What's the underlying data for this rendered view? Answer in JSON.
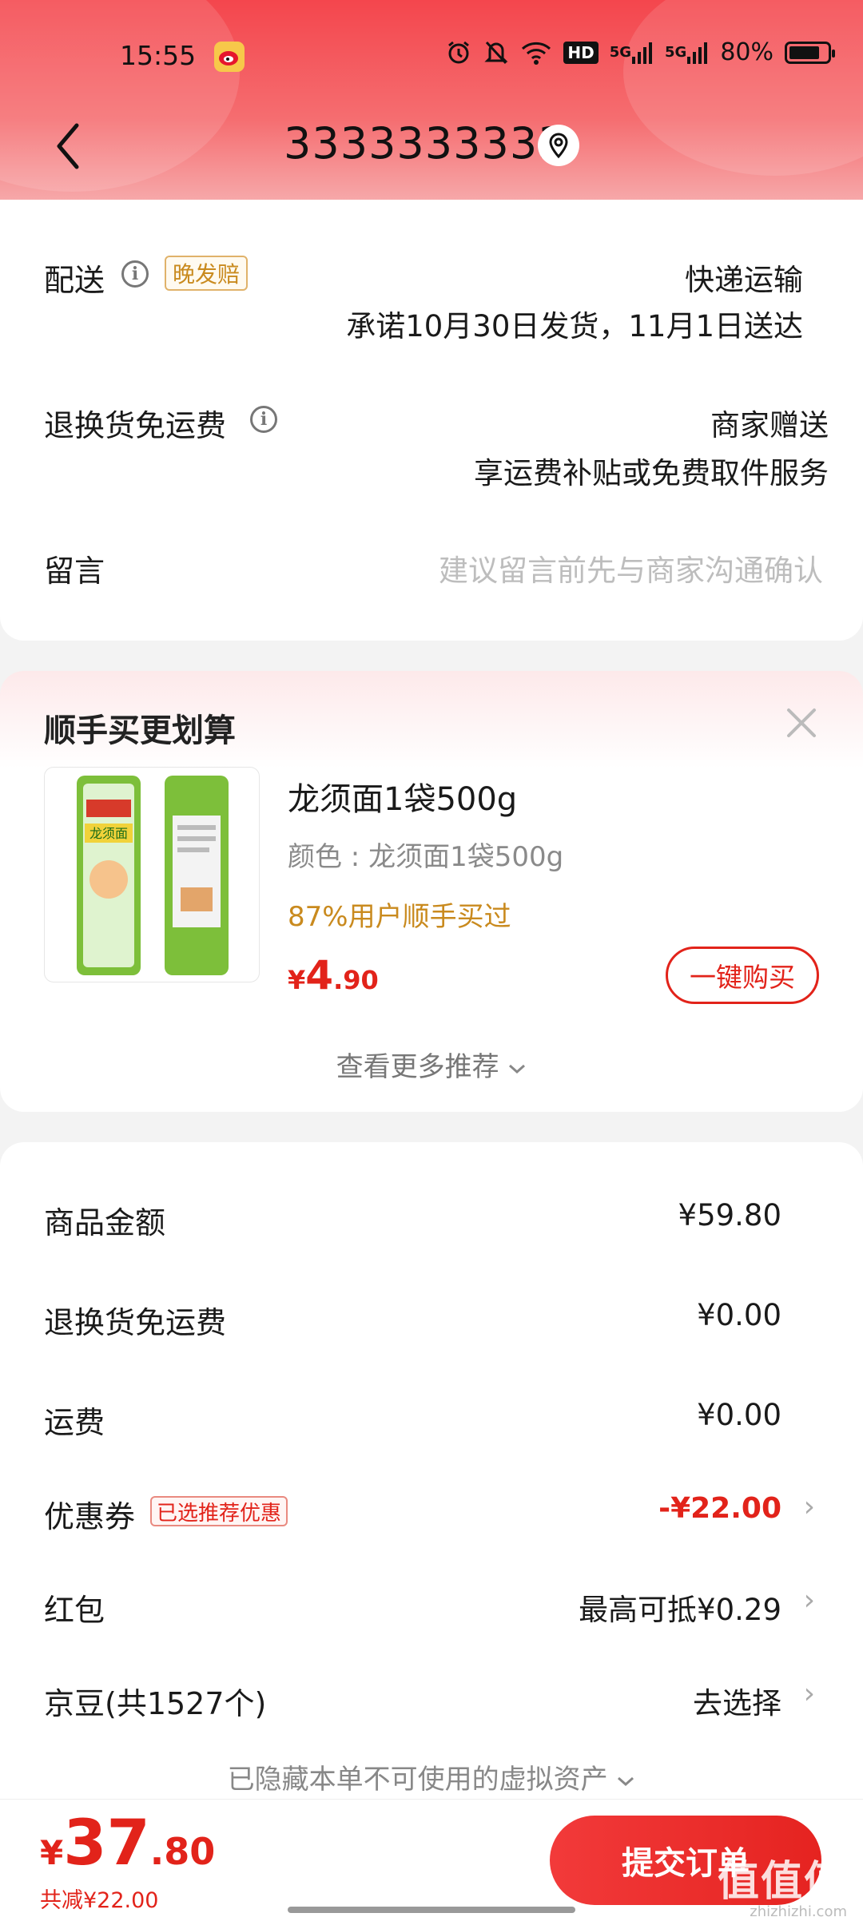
{
  "status_bar": {
    "time": "15:55",
    "network": "5G",
    "network2": "5G",
    "hd_badge": "HD",
    "battery": "80%",
    "battery_level": 0.8
  },
  "nav": {
    "title": "3333333333"
  },
  "delivery": {
    "label": "配送",
    "late_tag": "晚发赔",
    "method": "快递运输",
    "promise": "承诺10月30日发货，11月1日送达",
    "return_label": "退换货免运费",
    "return_value": "商家赠送",
    "return_desc": "享运费补贴或免费取件服务",
    "note_label": "留言",
    "note_placeholder": "建议留言前先与商家沟通确认"
  },
  "recommend": {
    "title": "顺手买更划算",
    "product": {
      "name": "龙须面1袋500g",
      "spec": "颜色 : 龙须面1袋500g",
      "stat": "87%用户顺手买过",
      "price_currency": "¥",
      "price_int": "4",
      "price_dec": ".90",
      "package_text": "龙须面"
    },
    "buy_label": "一键购买",
    "more_label": "查看更多推荐"
  },
  "summary": {
    "goods_label": "商品金额",
    "goods_value": "¥59.80",
    "return_label": "退换货免运费",
    "return_value": "¥0.00",
    "shipping_label": "运费",
    "shipping_value": "¥0.00",
    "coupon_label": "优惠券",
    "coupon_tag": "已选推荐优惠",
    "coupon_value": "-¥22.00",
    "redpacket_label": "红包",
    "redpacket_value": "最高可抵¥0.29",
    "jingdou_label": "京豆(共1527个)",
    "jingdou_value": "去选择",
    "hidden_note": "已隐藏本单不可使用的虚拟资产"
  },
  "bottom": {
    "currency": "¥",
    "total_int": "37",
    "total_dec": ".80",
    "saved": "共减¥22.00",
    "submit_label": "提交订单",
    "watermark": "值值值",
    "watermark_sub": "zhizhizhi.com"
  },
  "colors": {
    "accent": "#e2231a",
    "header": "#f4464d"
  }
}
